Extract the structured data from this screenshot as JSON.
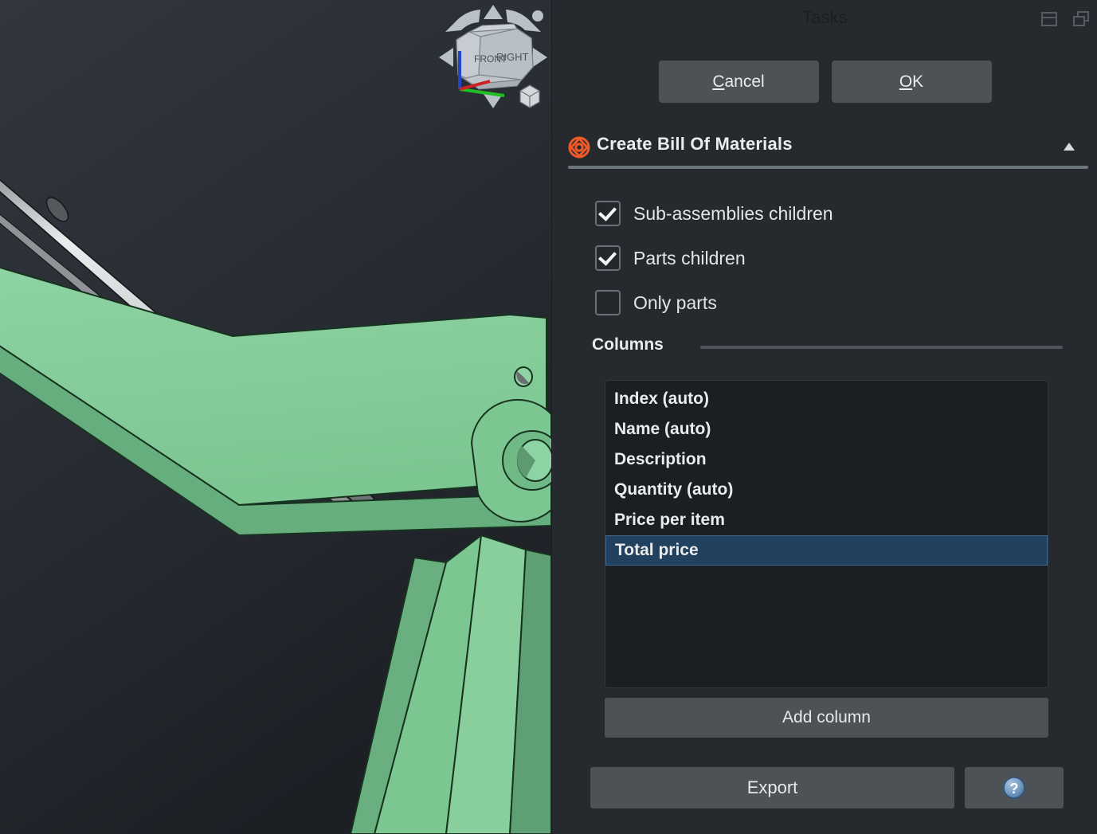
{
  "viewport": {
    "name": "3d-view",
    "background_color": "#272b31",
    "part_color": "#7ec694",
    "rod_color": "#c9ccce",
    "navcube": {
      "face_front_label": "FRONT",
      "face_right_label": "RIGHT",
      "arrow_up": "arrow-up",
      "arrow_down": "arrow-down",
      "arrow_left": "arrow-left",
      "arrow_right": "arrow-right",
      "rotate_left": "rotate-left-arc",
      "rotate_right": "rotate-right-arc",
      "corner_dot": "home-dot",
      "iso_cube": "iso-cube-icon",
      "axis_x_color": "#22c024",
      "axis_y_color": "#cc2222",
      "axis_z_color": "#2233cc"
    }
  },
  "panel": {
    "title": "Tasks",
    "dock_icon": "panel-dock-icon",
    "float_icon": "panel-float-icon",
    "accent_color": "#ef5a28",
    "buttons": {
      "cancel": {
        "prefix": "",
        "accel": "C",
        "suffix": "ancel"
      },
      "ok": {
        "prefix": "",
        "accel": "O",
        "suffix": "K"
      }
    },
    "section": {
      "icon": "bom-diamond-icon",
      "title": "Create Bill Of Materials",
      "collapse_icon": "collapse-up-icon"
    },
    "checkboxes": [
      {
        "label": "Sub-assemblies children",
        "checked": true
      },
      {
        "label": "Parts children",
        "checked": true
      },
      {
        "label": "Only parts",
        "checked": false
      }
    ],
    "columns_group": {
      "label": "Columns",
      "items": [
        {
          "label": "Index (auto)",
          "selected": false
        },
        {
          "label": "Name (auto)",
          "selected": false
        },
        {
          "label": "Description",
          "selected": false
        },
        {
          "label": "Quantity (auto)",
          "selected": false
        },
        {
          "label": "Price per item",
          "selected": false
        },
        {
          "label": "Total price",
          "selected": true
        }
      ],
      "add_column_label": "Add column"
    },
    "footer": {
      "export_label": "Export",
      "help_icon": "help-question-icon"
    }
  }
}
